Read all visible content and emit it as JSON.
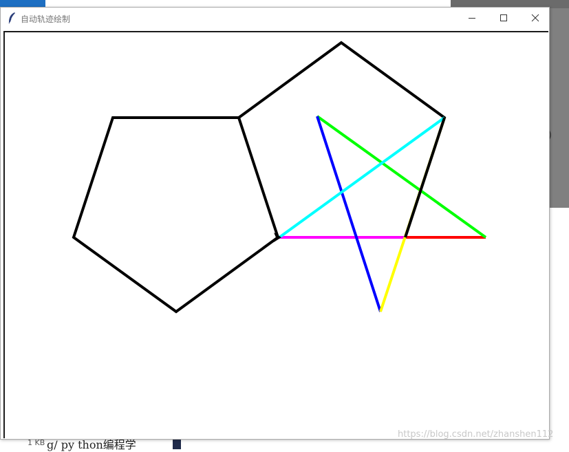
{
  "window": {
    "title": "自动轨迹绘制"
  },
  "background": {
    "file_size": "1 KB",
    "taskbar_item": "g/ py thon编程学",
    "watermark": "https://blog.csdn.net/zhanshen112"
  },
  "drawing": {
    "pen_color": "#000000",
    "stroke_colors": {
      "red": "#ff0000",
      "green": "#00ff00",
      "blue": "#0000ff",
      "cyan": "#00ffff",
      "magenta": "#ff00ff",
      "yellow": "#ffff00",
      "black": "#000000"
    },
    "shapes": [
      "pentagon",
      "pentagon",
      "five-pointed star"
    ]
  }
}
